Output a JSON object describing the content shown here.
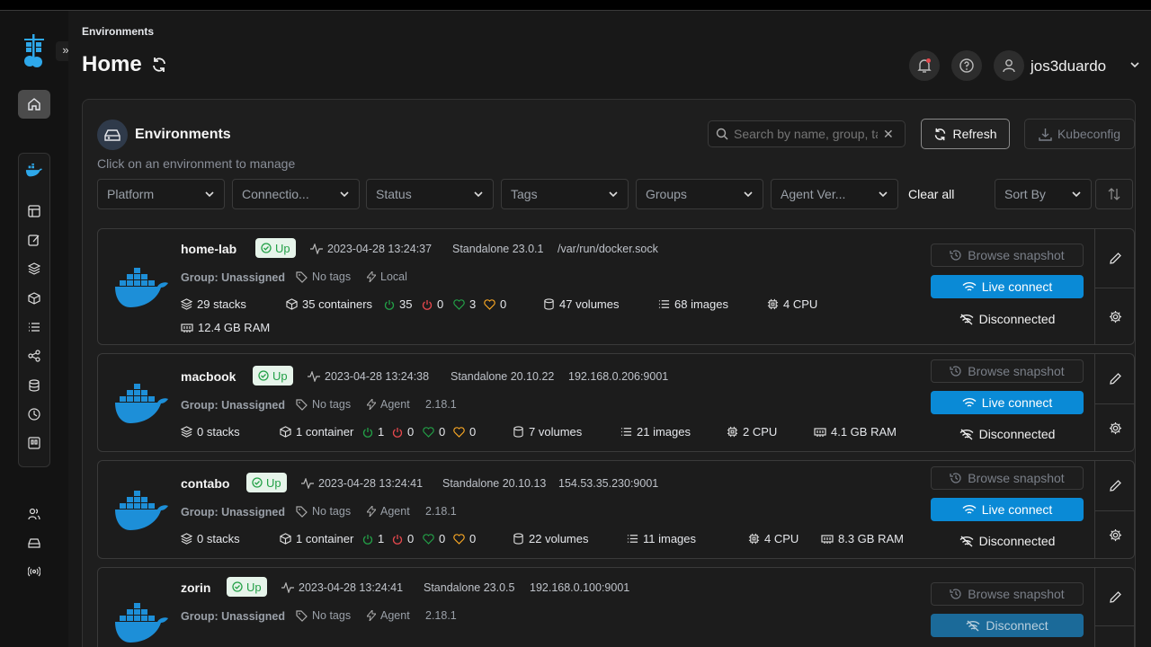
{
  "header": {
    "breadcrumb": "Environments",
    "title": "Home",
    "username": "jos3duardo"
  },
  "panel": {
    "title": "Environments",
    "subtitle": "Click on an environment to manage",
    "search_placeholder": "Search by name, group, tag, status, URL or IP",
    "search_value": "",
    "refresh_label": "Refresh",
    "kubeconfig_label": "Kubeconfig",
    "filters": [
      "Platform",
      "Connectio...",
      "Status",
      "Tags",
      "Groups",
      "Agent Ver..."
    ],
    "clear_all": "Clear all",
    "sort_by": "Sort By"
  },
  "environments": [
    {
      "name": "home-lab",
      "status": "Up",
      "timestamp": "2023-04-28 13:24:37",
      "type": "Standalone 23.0.1",
      "url": "/var/run/docker.sock",
      "group": "Group: Unassigned",
      "tags": "No tags",
      "connection": "Local",
      "agent_version": "",
      "stacks": "29 stacks",
      "containers": "35 containers",
      "running": "35",
      "stopped": "0",
      "healthy": "3",
      "unhealthy": "0",
      "volumes": "47 volumes",
      "images": "68 images",
      "cpu": "4 CPU",
      "ram": "12.4 GB RAM",
      "snapshot_label": "Browse snapshot",
      "live_label": "Live connect",
      "disconnect_label": "Disconnected"
    },
    {
      "name": "macbook",
      "status": "Up",
      "timestamp": "2023-04-28 13:24:38",
      "type": "Standalone 20.10.22",
      "url": "192.168.0.206:9001",
      "group": "Group: Unassigned",
      "tags": "No tags",
      "connection": "Agent",
      "agent_version": "2.18.1",
      "stacks": "0 stacks",
      "containers": "1 container",
      "running": "1",
      "stopped": "0",
      "healthy": "0",
      "unhealthy": "0",
      "volumes": "7 volumes",
      "images": "21 images",
      "cpu": "2 CPU",
      "ram": "4.1 GB RAM",
      "snapshot_label": "Browse snapshot",
      "live_label": "Live connect",
      "disconnect_label": "Disconnected"
    },
    {
      "name": "contabo",
      "status": "Up",
      "timestamp": "2023-04-28 13:24:41",
      "type": "Standalone 20.10.13",
      "url": "154.53.35.230:9001",
      "group": "Group: Unassigned",
      "tags": "No tags",
      "connection": "Agent",
      "agent_version": "2.18.1",
      "stacks": "0 stacks",
      "containers": "1 container",
      "running": "1",
      "stopped": "0",
      "healthy": "0",
      "unhealthy": "0",
      "volumes": "22 volumes",
      "images": "11 images",
      "cpu": "4 CPU",
      "ram": "8.3 GB RAM",
      "snapshot_label": "Browse snapshot",
      "live_label": "Live connect",
      "disconnect_label": "Disconnected"
    },
    {
      "name": "zorin",
      "status": "Up",
      "timestamp": "2023-04-28 13:24:41",
      "type": "Standalone 23.0.5",
      "url": "192.168.0.100:9001",
      "group": "Group: Unassigned",
      "tags": "No tags",
      "connection": "Agent",
      "agent_version": "2.18.1",
      "snapshot_label": "Browse snapshot",
      "disconnect_btn_label": "Disconnect"
    }
  ],
  "colors": {
    "accent": "#0a8ad6",
    "up_green": "#23a047",
    "danger": "#e5484d",
    "warning": "#f5a524",
    "background": "#181818"
  }
}
